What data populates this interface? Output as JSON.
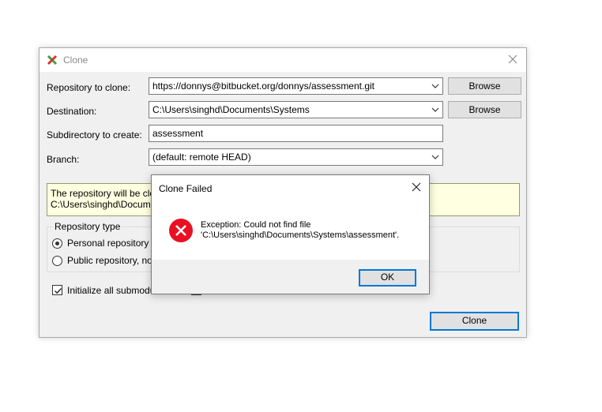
{
  "window": {
    "title": "Clone",
    "icon": "tortoisehg-icon",
    "close_icon": "close-icon"
  },
  "form": {
    "repo_label": "Repository to clone:",
    "repo_value": "https://donnys@bitbucket.org/donnys/assessment.git",
    "dest_label": "Destination:",
    "dest_value": "C:\\Users\\singhd\\Documents\\Systems",
    "subdir_label": "Subdirectory to create:",
    "subdir_value": "assessment",
    "branch_label": "Branch:",
    "branch_value": "(default: remote HEAD)",
    "browse_label": "Browse",
    "info_line1": "The repository will be clo",
    "info_line2": "C:\\Users\\singhd\\Docum"
  },
  "repo_type": {
    "title": "Repository type",
    "options": [
      "Personal repository",
      "Public repository, no"
    ],
    "selected": 0
  },
  "submodules": {
    "label": "Initialize all submodu",
    "checked": true
  },
  "actions": {
    "clone_label": "Clone"
  },
  "dialog": {
    "title": "Clone Failed",
    "message_line1": "Exception: Could not find file",
    "message_line2": "'C:\\Users\\singhd\\Documents\\Systems\\assessment'.",
    "ok_label": "OK",
    "icon": "error-icon"
  },
  "colors": {
    "accent": "#0078d7",
    "error": "#e81123",
    "info_background": "#ffffe1"
  }
}
